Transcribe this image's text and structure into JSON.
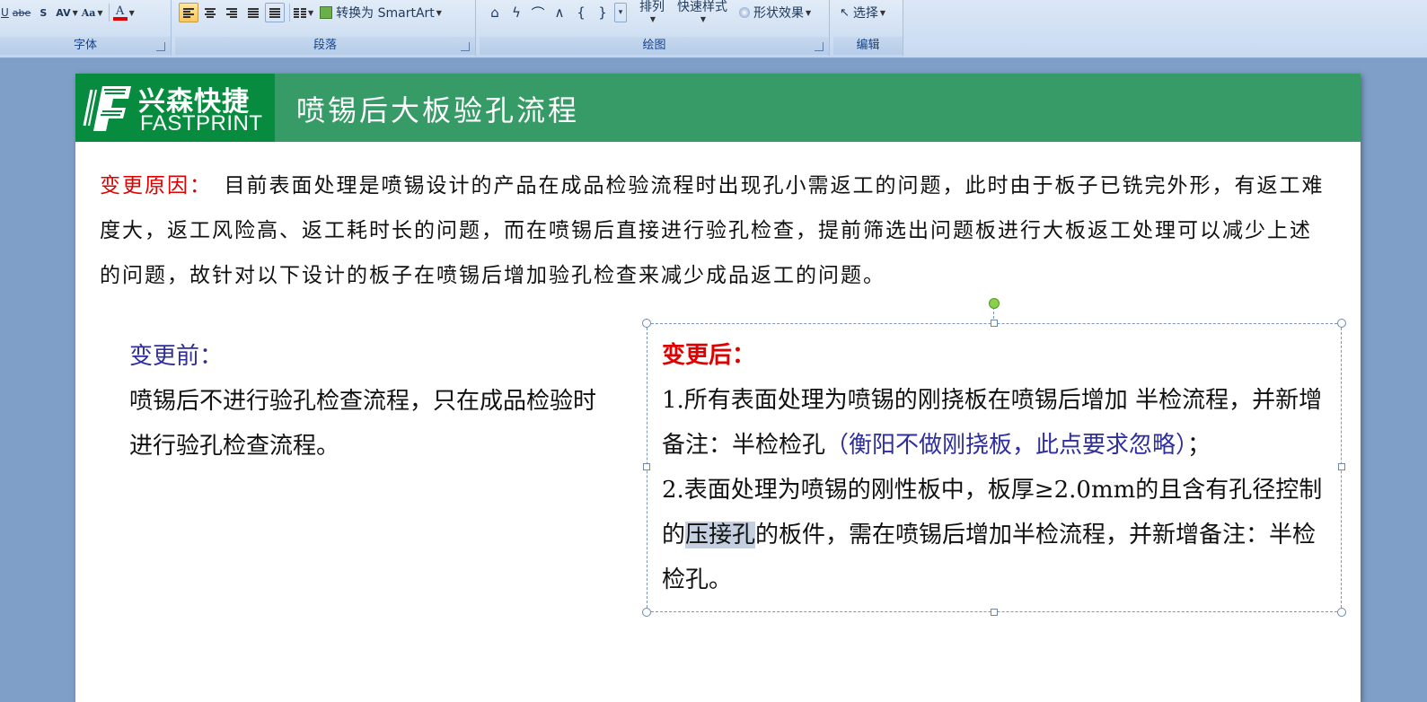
{
  "ribbon": {
    "font_group": {
      "label": "字体",
      "buttons": [
        "abe",
        "S",
        "AV",
        "Aa",
        "A"
      ]
    },
    "paragraph_group": {
      "label": "段落",
      "smartart_label": "转换为 SmartArt"
    },
    "drawing_group": {
      "label": "绘图",
      "arrange_label": "排列",
      "quick_style_label": "快速样式",
      "shape_effect_label": "形状效果"
    },
    "editing_group": {
      "label": "编辑",
      "select_label": "选择"
    }
  },
  "slide": {
    "logo_cn": "兴森快捷",
    "logo_en": "FASTPRINT",
    "title": "喷锡后大板验孔流程",
    "reason_label": "变更原因：",
    "reason_text": "目前表面处理是喷锡设计的产品在成品检验流程时出现孔小需返工的问题，此时由于板子已铣完外形，有返工难度大，返工风险高、返工耗时长的问题，而在喷锡后直接进行验孔检查，提前筛选出问题板进行大板返工处理可以减少上述的问题，故针对以下设计的板子在喷锡后增加验孔检查来减少成品返工的问题。",
    "before_label": "变更前：",
    "before_text": "喷锡后不进行验孔检查流程，只在成品检验时进行验孔检查流程。",
    "after_label": "变更后：",
    "after_item1_main": "1.所有表面处理为喷锡的刚挠板在喷锡后增加 半检流程，并新增备注：半检检孔",
    "after_item1_note": "（衡阳不做刚挠板，此点要求忽略）",
    "after_item1_end": "；",
    "after_item2_start": "2.表面处理为喷锡的刚性板中，板厚≥2.0mm的且含有孔径控制的",
    "after_item2_highlight": "压接孔",
    "after_item2_end": "的板件，需在喷锡后增加半检流程，并新增备注：半检检孔。"
  },
  "colors": {
    "banner_green": "#379b67",
    "logo_green": "#078c3f",
    "red_label": "#e00000",
    "blue_text": "#2e2e9e"
  }
}
